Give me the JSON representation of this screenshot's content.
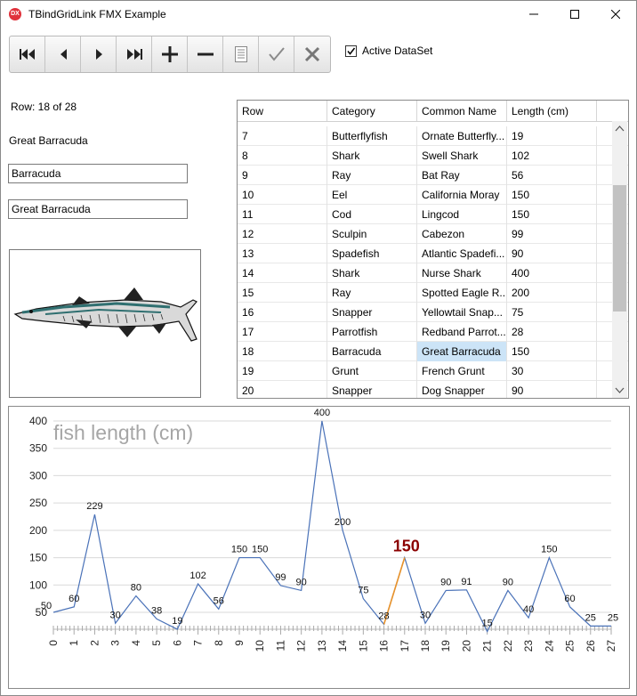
{
  "window": {
    "title": "TBindGridLink FMX Example",
    "app_icon_text": "DX",
    "icons": [
      "minimize-icon",
      "maximize-icon",
      "close-icon"
    ]
  },
  "toolbar": {
    "buttons": [
      "first-record",
      "prior-record",
      "next-record",
      "last-record",
      "insert-record",
      "delete-record",
      "edit-record",
      "post-record",
      "cancel-record"
    ]
  },
  "active_dataset": {
    "label": "Active DataSet",
    "checked": true
  },
  "detail": {
    "row_text": "Row: 18 of 28",
    "name_label": "Great Barracuda",
    "category_value": "Barracuda",
    "common_name_value": "Great Barracuda"
  },
  "grid": {
    "headers": [
      "Row",
      "Category",
      "Common Name",
      "Length (cm)"
    ],
    "rows": [
      [
        "7",
        "Butterflyfish",
        "Ornate Butterfly...",
        "19"
      ],
      [
        "8",
        "Shark",
        "Swell Shark",
        "102"
      ],
      [
        "9",
        "Ray",
        "Bat Ray",
        "56"
      ],
      [
        "10",
        "Eel",
        "California Moray",
        "150"
      ],
      [
        "11",
        "Cod",
        "Lingcod",
        "150"
      ],
      [
        "12",
        "Sculpin",
        "Cabezon",
        "99"
      ],
      [
        "13",
        "Spadefish",
        "Atlantic Spadefi...",
        "90"
      ],
      [
        "14",
        "Shark",
        "Nurse Shark",
        "400"
      ],
      [
        "15",
        "Ray",
        "Spotted Eagle R...",
        "200"
      ],
      [
        "16",
        "Snapper",
        "Yellowtail Snap...",
        "75"
      ],
      [
        "17",
        "Parrotfish",
        "Redband Parrot...",
        "28"
      ],
      [
        "18",
        "Barracuda",
        "Great Barracuda",
        "150"
      ],
      [
        "19",
        "Grunt",
        "French Grunt",
        "30"
      ],
      [
        "20",
        "Snapper",
        "Dog Snapper",
        "90"
      ]
    ],
    "selected_row": 18
  },
  "chart_data": {
    "type": "line",
    "title": "fish length (cm)",
    "x": [
      0,
      1,
      2,
      3,
      4,
      5,
      6,
      7,
      8,
      9,
      10,
      11,
      12,
      13,
      14,
      15,
      16,
      17,
      18,
      19,
      20,
      21,
      22,
      23,
      24,
      25,
      26,
      27
    ],
    "values": [
      50,
      60,
      229,
      30,
      80,
      38,
      19,
      102,
      56,
      150,
      150,
      99,
      90,
      400,
      200,
      75,
      28,
      150,
      30,
      90,
      91,
      15,
      90,
      40,
      150,
      60,
      25,
      25
    ],
    "yticks": [
      50,
      100,
      150,
      200,
      250,
      300,
      350,
      400
    ],
    "ylim": [
      0,
      400
    ],
    "highlight_index": 17,
    "highlight_label": "150",
    "colors": {
      "line": "#4a72b8",
      "highlight_line": "#e8922a",
      "highlight_label": "#8b0000",
      "title": "#a6a6a6"
    }
  }
}
